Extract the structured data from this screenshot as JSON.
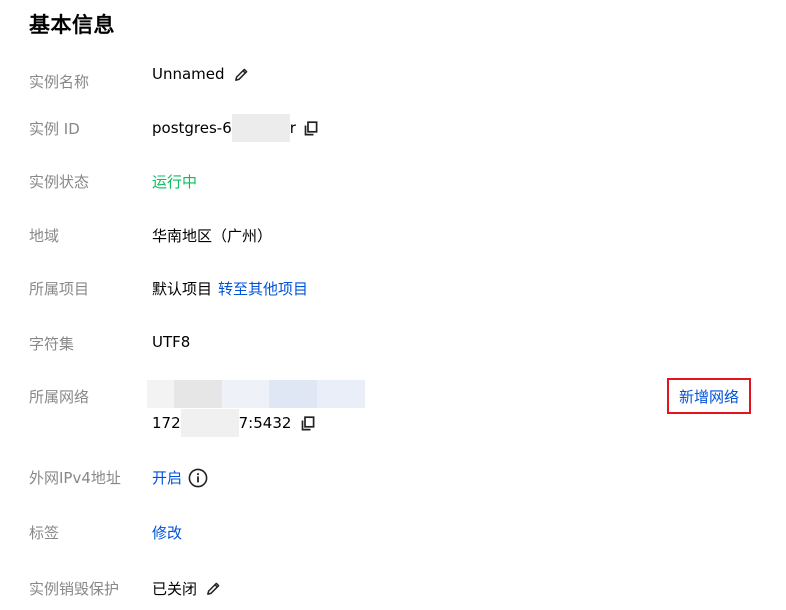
{
  "section_title": "基本信息",
  "instance_name": {
    "label": "实例名称",
    "value": "Unnamed",
    "edit_icon": "pencil-icon"
  },
  "instance_id": {
    "label": "实例 ID",
    "prefix": "postgres-6",
    "suffix": "r",
    "copy_icon": "copy-icon"
  },
  "instance_status": {
    "label": "实例状态",
    "value": "运行中",
    "color": "#0abf5b"
  },
  "region": {
    "label": "地域",
    "value": "华南地区（广州）"
  },
  "project": {
    "label": "所属项目",
    "value": "默认项目",
    "transfer_link": "转至其他项目"
  },
  "charset": {
    "label": "字符集",
    "value": "UTF8"
  },
  "network": {
    "label": "所属网络",
    "address_prefix": "172",
    "address_suffix": "7:5432",
    "add_network_button": "新增网络",
    "highlight_color": "#e3141e",
    "copy_icon": "copy-icon"
  },
  "public_ipv4": {
    "label": "外网IPv4地址",
    "link": "开启",
    "info_icon": "info-icon"
  },
  "tags": {
    "label": "标签",
    "link": "修改"
  },
  "deletion_protection": {
    "label": "实例销毁保护",
    "value": "已关闭",
    "edit_icon": "pencil-icon"
  },
  "colors": {
    "link": "#0052d9",
    "label": "#888888",
    "status_green": "#0abf5b"
  }
}
